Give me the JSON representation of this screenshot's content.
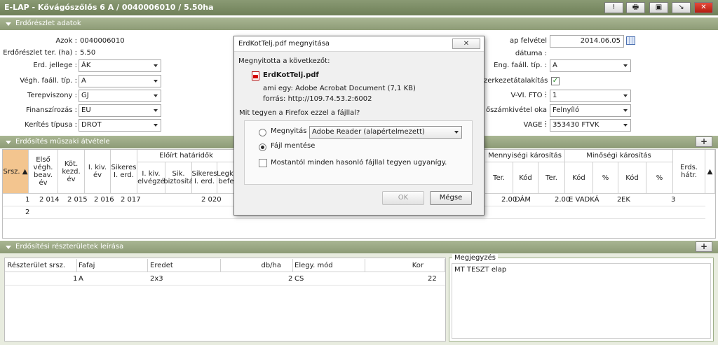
{
  "window": {
    "title": "E-LAP - Kővágószőlős 6 A / 0040006010 / 5.50ha",
    "buttons": [
      "!",
      "🖶",
      "▣",
      "↘",
      "✕"
    ]
  },
  "sections": {
    "erdoreszlet": "Erdőrészlet adatok",
    "erdosites": "Erdősítés műszaki átvétele",
    "reszteruletek": "Erdősítési részterületek leírása"
  },
  "erdoreszlet": {
    "azok_label": "Azok :",
    "azok_value": "0040006010",
    "ter_label": "Erdőrészlet ter. (ha) :",
    "ter_value": "5.50",
    "jellege_label": "Erd. jellege :",
    "jellege_value": "ÁK",
    "vegh_label": "Végh. faáll. típ. :",
    "vegh_value": "A",
    "terep_label": "Terepviszony :",
    "terep_value": "GJ",
    "finansz_label": "Finanszírozás :",
    "finansz_value": "EU",
    "kerites_label": "Kerítés típusa :",
    "kerites_value": "DROT",
    "felvetel_label": "ap felvétel dátuma :",
    "felvetel_value": "2014.06.05",
    "eng_label": "Eng. faáll. típ. :",
    "eng_value": "A",
    "szerkezet_label": "zerkezetátalakítás :",
    "fto_label": "V-VI. FTO :",
    "fto_value": "1",
    "szamkivetel_label": "őszámkivétel oka :",
    "szamkivetel_value": "Felnyíló",
    "vage_label": "VAGE :",
    "vage_value": "353430 FTVK"
  },
  "erdosites_grid": {
    "headers": {
      "srsz": "Srsz.",
      "elso_vegh": "Első végh. beav. év",
      "kot_kezd": "Köt. kezd. év",
      "i_kiv": "I. kiv. év",
      "sikeres": "Sikeres I. erd.",
      "eloirt": "Előírt határidők",
      "i_kiv_elvegz": "I. kiv. elvégzé",
      "sik_biztosita": "Sik. biztosítá",
      "sikeres_i_erd": "Sikeres I. erd.",
      "legk_bef": "Legk. befe",
      "mennyisegi": "Mennyiségi károsítás",
      "minosegi": "Minőségi károsítás",
      "ter1": "Ter.",
      "kod1": "Kód",
      "ter2": "Ter.",
      "kod2": "Kód",
      "pct1": "%",
      "kod3": "Kód",
      "pct2": "%",
      "erds_hatr": "Erds. hátr."
    },
    "rows": [
      {
        "srsz": "1",
        "elso": "2 014",
        "kot": "2 015",
        "ikiv": "2 016",
        "sik": "2 017",
        "sikerd": "2 020",
        "ter1": "2.00",
        "kod1": "DÁM",
        "ter2": "2.00",
        "kod2": "E VADKÁ",
        "pct1": "2",
        "kod3": "EK",
        "pct2": "3"
      },
      {
        "srsz": "2"
      }
    ]
  },
  "reszterulet_grid": {
    "headers": [
      "Részterület srsz.",
      "Fafaj",
      "Eredet",
      "db/ha",
      "Elegy. mód",
      "Kor"
    ],
    "rows": [
      {
        "srsz": "1",
        "fafaj": "A",
        "eredet": "2x3",
        "dbha": "2",
        "elegy": "CS",
        "kor": "22"
      }
    ]
  },
  "notes": {
    "label": "Megjegyzés",
    "text": "MT TESZT elap"
  },
  "dialog": {
    "title": "ErdKotTelj.pdf megnyitása",
    "close": "✕",
    "intro": "Megnyitotta a következőt:",
    "filename": "ErdKotTelj.pdf",
    "type_line": "ami egy:  Adobe Acrobat Document (7,1 KB)",
    "source_line": "forrás:  http://109.74.53.2:6002",
    "question": "Mit tegyen a Firefox ezzel a fájllal?",
    "open_with_label": "Megnyitás",
    "open_with_value": "Adobe Reader  (alapértelmezett)",
    "save_label": "Fájl mentése",
    "remember_label": "Mostantól minden hasonló fájllal tegyen ugyanígy.",
    "ok": "OK",
    "cancel": "Mégse"
  }
}
